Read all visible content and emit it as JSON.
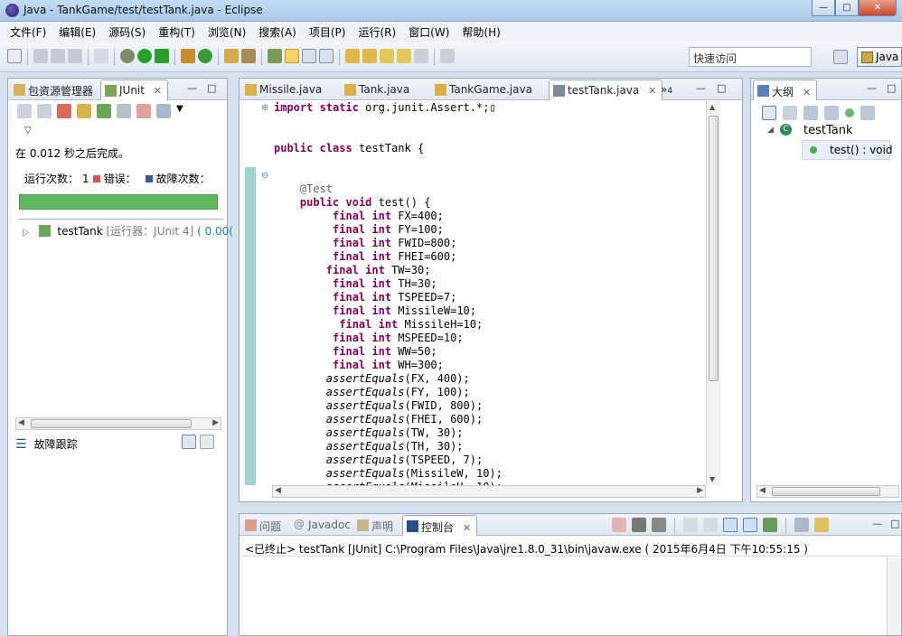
{
  "window": {
    "title": "Java  -  TankGame/test/testTank.java  -  Eclipse"
  },
  "menu": [
    "文件(F)",
    "编辑(E)",
    "源码(S)",
    "重构(T)",
    "浏览(N)",
    "搜索(A)",
    "项目(P)",
    "运行(R)",
    "窗口(W)",
    "帮助(H)"
  ],
  "toolbar": {
    "quick_access": "快速访问",
    "perspective": "Java"
  },
  "left_panel": {
    "tabs": [
      "包资源管理器",
      "JUnit"
    ],
    "status_message": "在 0.012 秒之后完成。",
    "runs_label": "运行次数：",
    "runs_value": "1",
    "errors_label": "错误：",
    "failures_label": "故障次数：",
    "progress": 1.0,
    "progress_color": "#5cb85c",
    "tree_item": {
      "name": "testTank",
      "runner": "[运行器：JUnit 4]",
      "time": "( 0.00("
    },
    "failure_trace_label": "故障跟踪"
  },
  "editor": {
    "tabs": [
      {
        "label": "Missile.java",
        "active": false
      },
      {
        "label": "Tank.java",
        "active": false
      },
      {
        "label": "TankGame.java",
        "active": false
      },
      {
        "label": "testTank.java",
        "active": true
      }
    ],
    "overflow_count": "4"
  },
  "outline": {
    "tab_label": "大纲",
    "class_name": "testTank",
    "method": "test() : void"
  },
  "console": {
    "tabs": [
      "问题",
      "Javadoc",
      "声明",
      "控制台"
    ],
    "terminated_line": "<已终止> testTank [JUnit] C:\\Program Files\\Java\\jre1.8.0_31\\bin\\javaw.exe ( 2015年6月4日 下午10:55:15 )"
  }
}
